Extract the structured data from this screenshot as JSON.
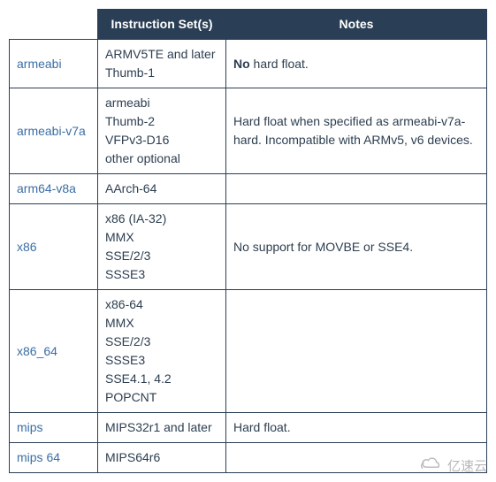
{
  "headers": {
    "abi": "",
    "inst": "Instruction Set(s)",
    "notes": "Notes"
  },
  "rows": [
    {
      "abi": "armeabi",
      "inst": [
        "ARMV5TE and later",
        "Thumb-1"
      ],
      "notes_bold": "No",
      "notes_rest": " hard float."
    },
    {
      "abi": "armeabi-v7a",
      "inst": [
        "armeabi",
        "Thumb-2",
        "VFPv3-D16",
        "other optional"
      ],
      "notes_plain": "Hard float when specified as armeabi-v7a-hard. Incompatible with ARMv5, v6 devices."
    },
    {
      "abi": "arm64-v8a",
      "inst": [
        "AArch-64"
      ],
      "notes_plain": ""
    },
    {
      "abi": "x86",
      "inst": [
        "x86 (IA-32)",
        "MMX",
        "SSE/2/3",
        "SSSE3"
      ],
      "notes_plain": "No support for MOVBE or SSE4."
    },
    {
      "abi": "x86_64",
      "inst": [
        "x86-64",
        "MMX",
        "SSE/2/3",
        "SSSE3",
        "SSE4.1, 4.2",
        "POPCNT"
      ],
      "notes_plain": ""
    },
    {
      "abi": "mips",
      "inst": [
        "MIPS32r1 and later"
      ],
      "notes_plain": "Hard float."
    },
    {
      "abi": "mips 64",
      "inst": [
        "MIPS64r6"
      ],
      "notes_plain": ""
    }
  ],
  "watermark": "亿速云"
}
